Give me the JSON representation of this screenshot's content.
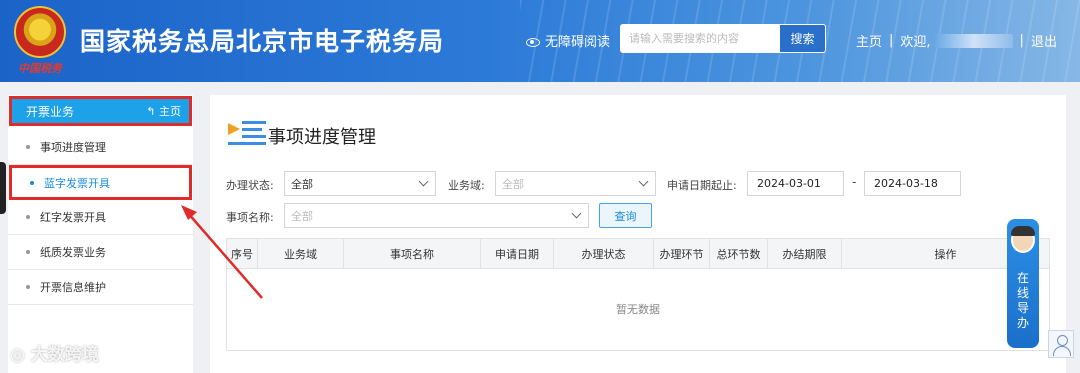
{
  "header": {
    "title": "国家税务总局北京市电子税务局",
    "emblem_caption": "中国税务",
    "accessible_label": "无障碍阅读",
    "search_placeholder": "请输入需要搜索的内容",
    "search_button": "搜索",
    "nav": {
      "home": "主页",
      "welcome": "欢迎,",
      "logout": "退出"
    }
  },
  "sidebar": {
    "section_title": "开票业务",
    "home_link": "主页",
    "items": [
      {
        "label": "事项进度管理"
      },
      {
        "label": "蓝字发票开具",
        "active": true
      },
      {
        "label": "红字发票开具"
      },
      {
        "label": "纸质发票业务"
      },
      {
        "label": "开票信息维护"
      }
    ]
  },
  "main": {
    "page_title": "事项进度管理",
    "filters": {
      "status_label": "办理状态:",
      "status_value": "全部",
      "domain_label": "业务域:",
      "domain_placeholder": "全部",
      "date_label": "申请日期起止:",
      "date_from": "2024-03-01",
      "date_sep": "-",
      "date_to": "2024-03-18",
      "name_label": "事项名称:",
      "name_placeholder": "全部",
      "query_button": "查询"
    },
    "table": {
      "columns": [
        "序号",
        "业务域",
        "事项名称",
        "申请日期",
        "办理状态",
        "办理环节",
        "总环节数",
        "办结期限",
        "操作"
      ],
      "empty_text": "暂无数据"
    }
  },
  "guide": {
    "label": "在线导办"
  },
  "watermark": "大数跨境",
  "colors": {
    "header_blue": "#1c63c8",
    "sidebar_active_bg": "#1da1e8",
    "highlight_red": "#e02b2b",
    "link_blue": "#1a8be0"
  }
}
